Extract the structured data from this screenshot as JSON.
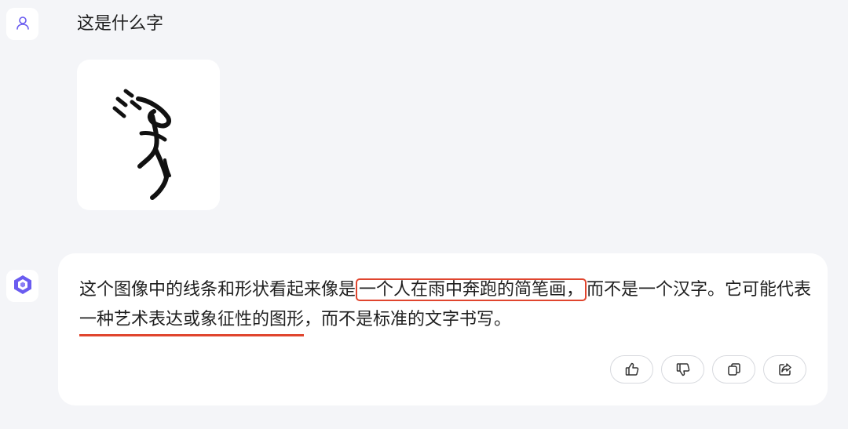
{
  "user_message": {
    "avatar_icon": "user-icon",
    "text": "这是什么字",
    "image_icon": "ancient-glyph-image"
  },
  "assistant_message": {
    "avatar_icon": "assistant-logo-icon",
    "text_before_box": "这个图像中的线条和形状看起来像是",
    "text_boxed": "一个人在雨中奔跑的简笔画，",
    "text_mid": "而不是一个汉字。它可能代表",
    "text_underlined": "一种艺术表达或象征性的图形",
    "text_after": "，而不是标准的文字书写。",
    "actions": [
      {
        "icon": "thumbs-up-icon"
      },
      {
        "icon": "thumbs-down-icon"
      },
      {
        "icon": "copy-icon"
      },
      {
        "icon": "share-icon"
      }
    ]
  },
  "colors": {
    "page_bg": "#f4f5f8",
    "card_bg": "#ffffff",
    "annotation_red": "#e0452e",
    "assistant_logo": "#6a5cf0"
  }
}
